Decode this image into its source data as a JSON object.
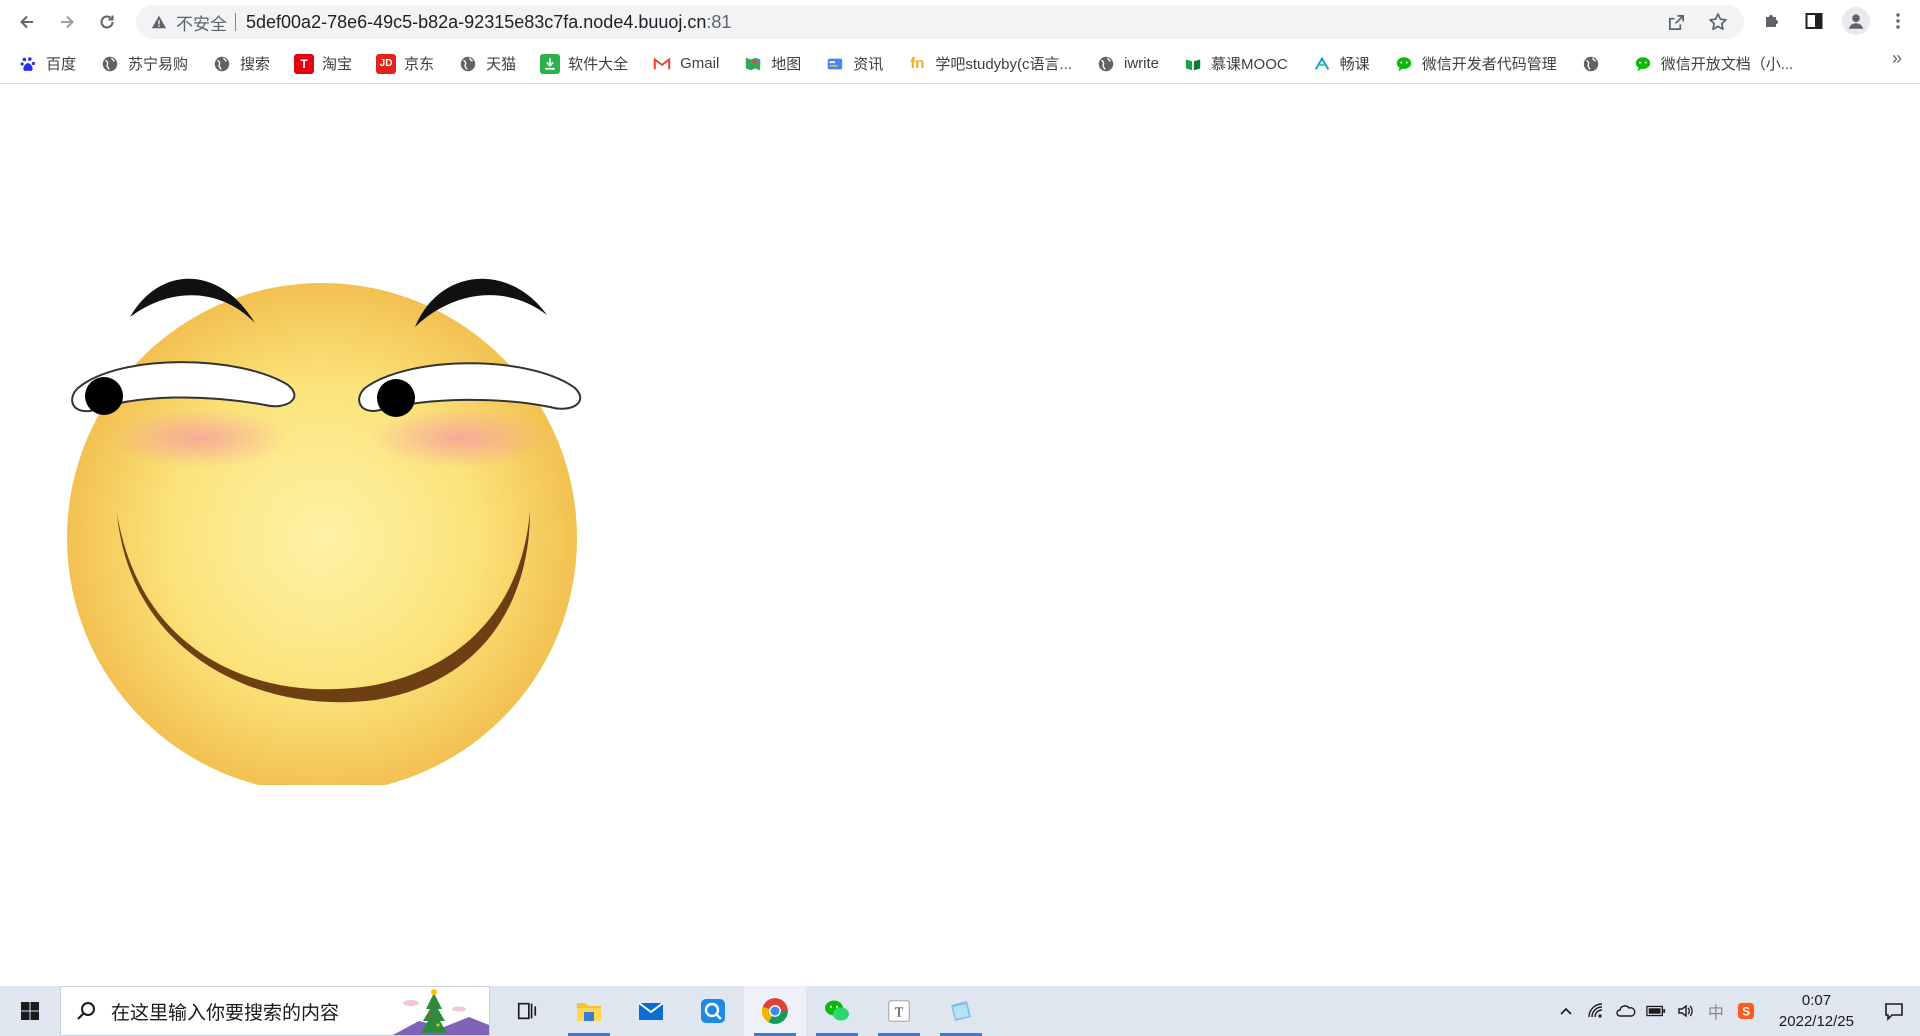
{
  "browser": {
    "security_label": "不安全",
    "url_host": "5def00a2-78e6-49c5-b82a-92315e83c7fa.node4.buuoj.cn",
    "url_port": ":81",
    "icons": {
      "back": "arrow-left-icon",
      "forward": "arrow-right-icon",
      "reload": "reload-icon",
      "warning": "warning-triangle-icon",
      "share": "share-icon",
      "bookmark": "star-icon",
      "extensions": "puzzle-icon",
      "side_panel": "side-panel-icon",
      "profile": "profile-avatar-icon",
      "menu": "kebab-menu-icon"
    }
  },
  "bookmarks": [
    {
      "label": "百度",
      "icon": "baidu-icon",
      "color": "#2932e1"
    },
    {
      "label": "苏宁易购",
      "icon": "globe-icon",
      "color": "#5f6368"
    },
    {
      "label": "搜索",
      "icon": "globe-icon",
      "color": "#5f6368"
    },
    {
      "label": "淘宝",
      "icon": "tmall-icon",
      "color": "#e60012"
    },
    {
      "label": "京东",
      "icon": "jd-icon",
      "color": "#e1251b"
    },
    {
      "label": "天猫",
      "icon": "globe-icon",
      "color": "#5f6368"
    },
    {
      "label": "软件大全",
      "icon": "download-icon",
      "color": "#2bb24c"
    },
    {
      "label": "Gmail",
      "icon": "gmail-icon",
      "color": "#ea4335"
    },
    {
      "label": "地图",
      "icon": "maps-icon",
      "color": "#34a853"
    },
    {
      "label": "资讯",
      "icon": "news-icon",
      "color": "#4285f4"
    },
    {
      "label": "学吧studyby(c语言...",
      "icon": "studyby-icon",
      "color": "#f5a623"
    },
    {
      "label": "iwrite",
      "icon": "globe-icon",
      "color": "#5f6368"
    },
    {
      "label": "慕课MOOC",
      "icon": "mooc-icon",
      "color": "#1aa34a"
    },
    {
      "label": "畅课",
      "icon": "changke-icon",
      "color": "#18a0c8"
    },
    {
      "label": "微信开发者代码管理",
      "icon": "wechat-icon",
      "color": "#09bb07"
    },
    {
      "label": "",
      "icon": "globe-icon",
      "color": "#5f6368"
    },
    {
      "label": "微信开放文档（小...",
      "icon": "wechat-icon",
      "color": "#09bb07"
    }
  ],
  "bookmarks_more": "»",
  "page": {
    "image": "smirking-emoji-face",
    "colors": {
      "face_light": "#fdf07e",
      "face_dark": "#f0b846",
      "brow": "#111111",
      "mouth": "#6e3f12",
      "blush": "#f6a0a0"
    }
  },
  "taskbar": {
    "search_placeholder": "在这里输入你要搜索的内容",
    "apps": [
      {
        "name": "task-view-icon"
      },
      {
        "name": "file-explorer-icon"
      },
      {
        "name": "mail-icon"
      },
      {
        "name": "app-store-icon"
      },
      {
        "name": "chrome-icon"
      },
      {
        "name": "wechat-icon"
      },
      {
        "name": "typora-icon"
      },
      {
        "name": "notes-icon"
      }
    ],
    "tray": {
      "ime": "中",
      "time": "0:07",
      "date": "2022/12/25"
    }
  }
}
